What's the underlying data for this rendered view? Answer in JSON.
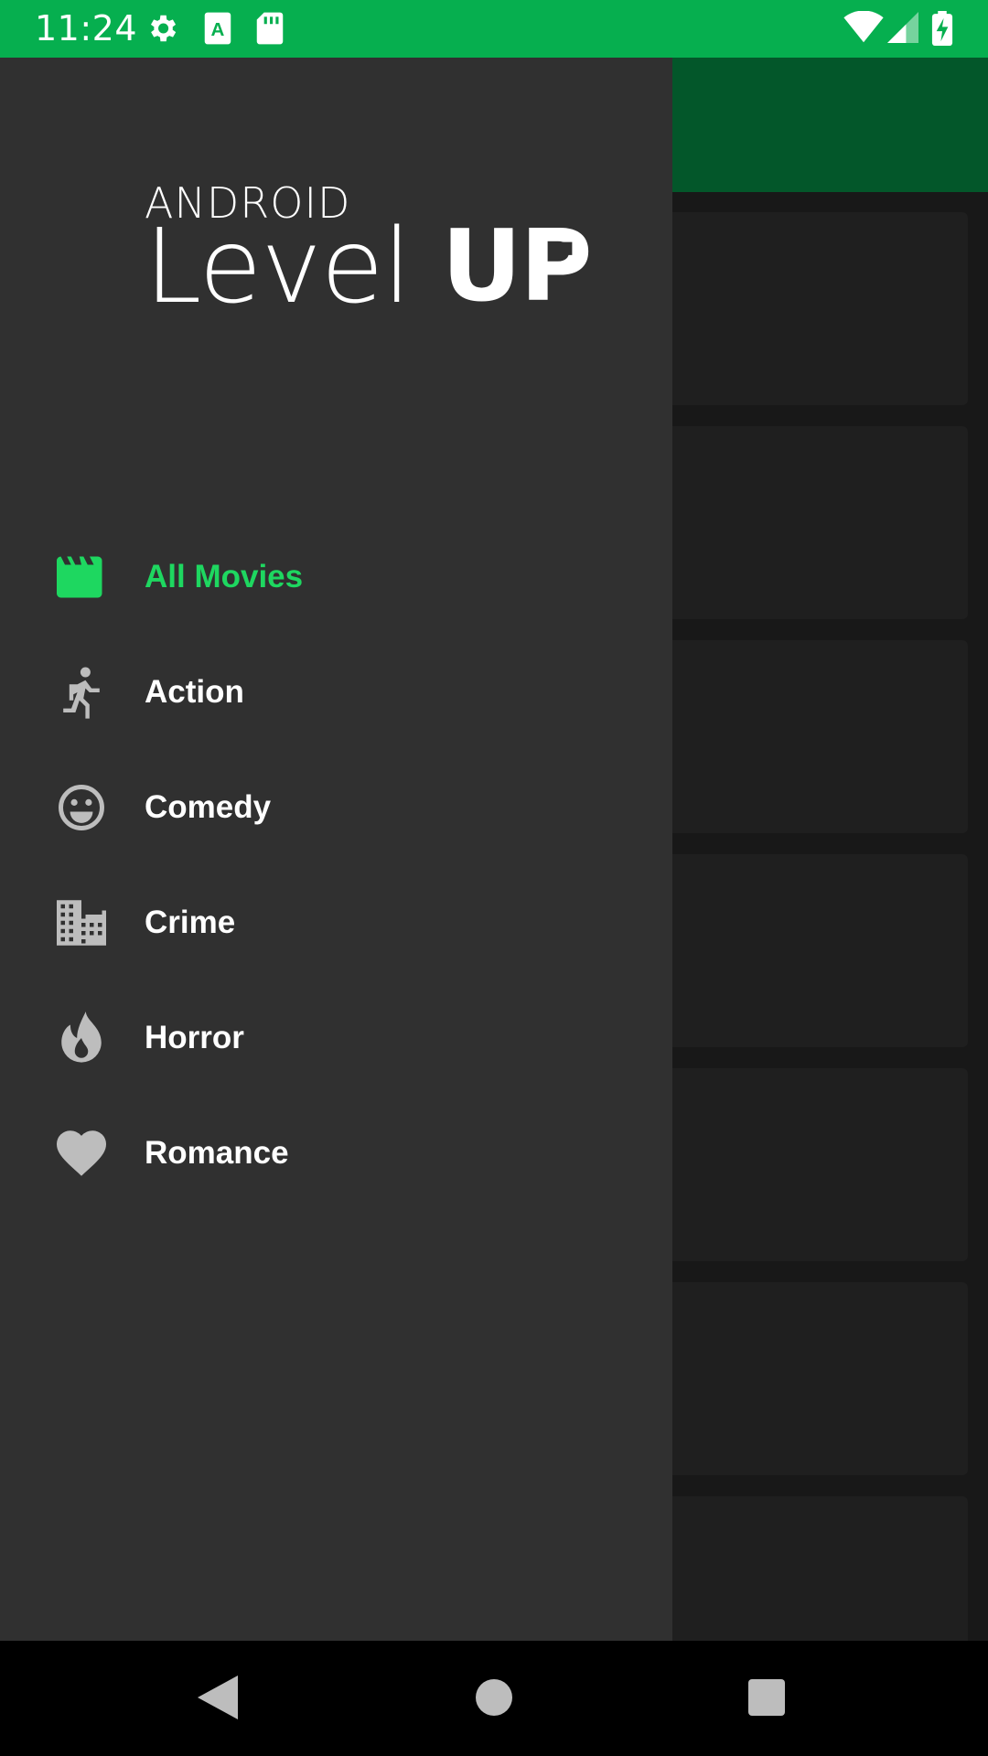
{
  "status_bar": {
    "time": "11:24",
    "left_icons": [
      "gear-icon",
      "accessibility-a-icon",
      "sd-card-icon"
    ],
    "right_icons": [
      "wifi-icon",
      "cell-signal-icon",
      "battery-charging-icon"
    ],
    "background_color": "#06AF4F"
  },
  "brand": {
    "top": "ANDROID",
    "level": "Level",
    "up": "UP"
  },
  "drawer": {
    "background_color": "#303030",
    "accent_color": "#1ED760",
    "items": [
      {
        "label": "All Movies",
        "icon": "movie-clapper-icon",
        "selected": true
      },
      {
        "label": "Action",
        "icon": "running-person-icon",
        "selected": false
      },
      {
        "label": "Comedy",
        "icon": "smiley-face-icon",
        "selected": false
      },
      {
        "label": "Crime",
        "icon": "building-icon",
        "selected": false
      },
      {
        "label": "Horror",
        "icon": "flame-icon",
        "selected": false
      },
      {
        "label": "Romance",
        "icon": "heart-icon",
        "selected": false
      }
    ]
  },
  "app": {
    "toolbar_color": "#03572A"
  },
  "nav_bar": {
    "buttons": [
      "back-icon",
      "home-icon",
      "recents-icon"
    ]
  }
}
